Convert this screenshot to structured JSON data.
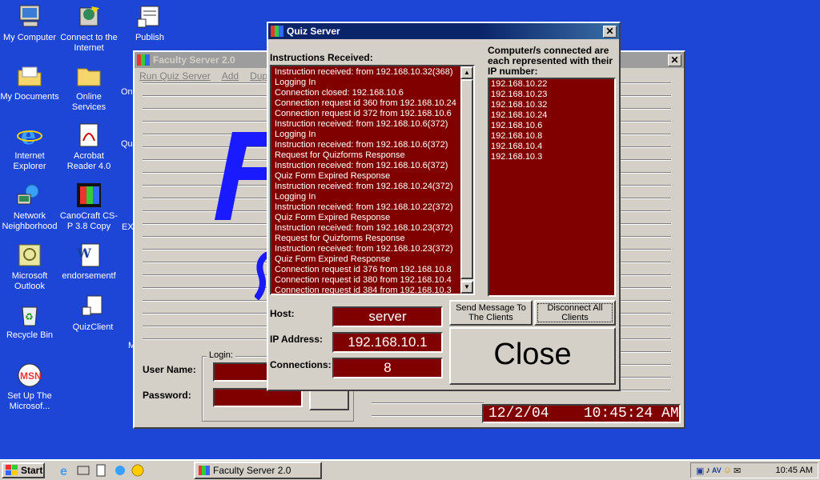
{
  "desktop": {
    "icons": [
      {
        "label": "My Computer"
      },
      {
        "label": "Connect to the Internet"
      },
      {
        "label": "Publish"
      },
      {
        "label": "My Documents"
      },
      {
        "label": "Online Services"
      },
      {
        "label": "Internet Explorer"
      },
      {
        "label": "Acrobat Reader 4.0"
      },
      {
        "label": "Network Neighborhood"
      },
      {
        "label": "CanoCraft CS-P 3.8 Copy"
      },
      {
        "label": "Microsoft Outlook"
      },
      {
        "label": "endorsementf"
      },
      {
        "label": "Recycle Bin"
      },
      {
        "label": "QuizClient"
      },
      {
        "label": "Set Up The Microsof..."
      }
    ],
    "partial_labels": [
      "On",
      "Qu",
      "EX",
      "M"
    ]
  },
  "faculty_window": {
    "title": "Faculty Server 2.0",
    "menu": [
      "Run Quiz Server",
      "Add",
      "Duplicat"
    ],
    "login_group": "Login:",
    "user_name_label": "User Name:",
    "password_label": "Password:",
    "datetime": "12/2/04    10:45:24 AM"
  },
  "quiz_window": {
    "title": "Quiz Server",
    "instructions_label": "Instructions Received:",
    "instructions": [
      "Instruction received:  from 192.168.10.32(368)",
      "Logging In",
      "Connection closed: 192.168.10.6",
      "Connection request id 360 from 192.168.10.24",
      "Connection request id 372 from 192.168.10.6",
      "Instruction received:  from 192.168.10.6(372)",
      "Logging In",
      "Instruction received:  from 192.168.10.6(372)",
      "Request for Quizforms Response",
      "Instruction received:  from 192.168.10.6(372)",
      "Quiz Form Expired Response",
      "Instruction received:  from 192.168.10.24(372)",
      "Logging In",
      "Instruction received:  from 192.168.10.22(372)",
      "Quiz Form Expired Response",
      "Instruction received:  from 192.168.10.23(372)",
      "Request for Quizforms Response",
      "Instruction received:  from 192.168.10.23(372)",
      "Quiz Form Expired Response",
      "Connection request id 376 from 192.168.10.8",
      "Connection request id 380 from 192.168.10.4",
      "Connection request id 384 from 192.168.10.3"
    ],
    "computers_label": "Computer/s connected are each represented with their IP number:",
    "computers": [
      "192.168.10.22",
      "192.168.10.23",
      "192.168.10.32",
      "192.168.10.24",
      "192.168.10.6",
      "192.168.10.8",
      "192.168.10.4",
      "192.168.10.3"
    ],
    "host_label": "Host:",
    "host_value": "server",
    "ip_label": "IP Address:",
    "ip_value": "192.168.10.1",
    "connections_label": "Connections:",
    "connections_value": "8",
    "send_button": "Send Message To The Clients",
    "disconnect_button": "Disconnect All Clients",
    "close_button": "Close"
  },
  "taskbar": {
    "start_label": "Start",
    "task_label": "Faculty Server 2.0",
    "clock": "10:45 AM"
  },
  "colors": {
    "desktop": "#1d46d6",
    "accent_red": "#800000"
  }
}
